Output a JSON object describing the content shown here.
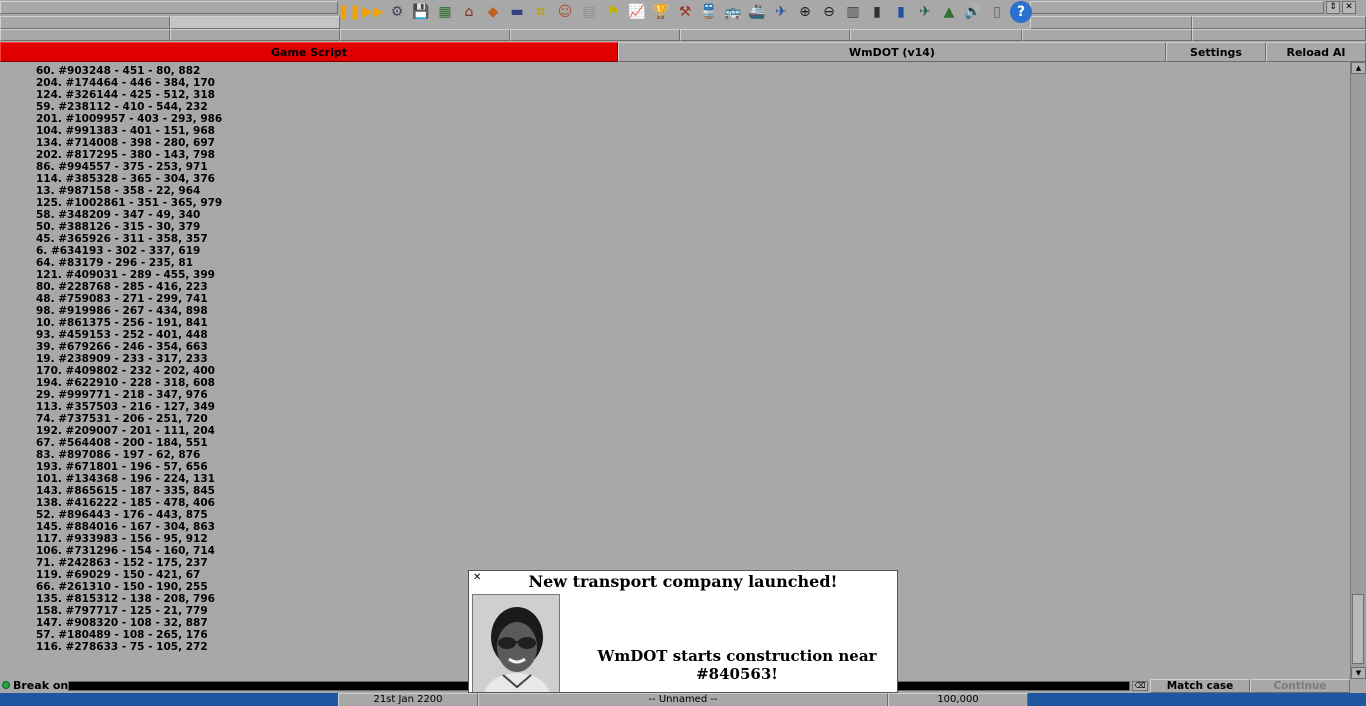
{
  "toolbar": {
    "window_buttons": [
      "⇕",
      "✕"
    ],
    "icons": [
      {
        "name": "pause-icon",
        "glyph": "❚❚",
        "color": "#f0a000"
      },
      {
        "name": "fast-forward-icon",
        "glyph": "▶▶",
        "color": "#f0a000"
      },
      {
        "name": "settings-gear-icon",
        "glyph": "⚙",
        "color": "#404860"
      },
      {
        "name": "save-icon",
        "glyph": "💾",
        "color": "#2040a0"
      },
      {
        "name": "map-icon",
        "glyph": "▦",
        "color": "#307030"
      },
      {
        "name": "town-directory-icon",
        "glyph": "⌂",
        "color": "#803020"
      },
      {
        "name": "subsidies-icon",
        "glyph": "◆",
        "color": "#c06020"
      },
      {
        "name": "station-list-icon",
        "glyph": "▬",
        "color": "#304080"
      },
      {
        "name": "finances-icon",
        "glyph": "¤",
        "color": "#c0a000"
      },
      {
        "name": "company-icon",
        "glyph": "☺",
        "color": "#b05030"
      },
      {
        "name": "story-book-icon",
        "glyph": "▤",
        "color": "#909090"
      },
      {
        "name": "goals-icon",
        "glyph": "⚑",
        "color": "#c0b000"
      },
      {
        "name": "graphs-icon",
        "glyph": "📈",
        "color": "#2050c0"
      },
      {
        "name": "league-table-icon",
        "glyph": "🏆",
        "color": "#d0a000"
      },
      {
        "name": "industries-icon",
        "glyph": "⚒",
        "color": "#a03020"
      },
      {
        "name": "trains-icon",
        "glyph": "🚆",
        "color": "#2050a0"
      },
      {
        "name": "road-vehicles-icon",
        "glyph": "🚌",
        "color": "#2050c0"
      },
      {
        "name": "ships-icon",
        "glyph": "🚢",
        "color": "#505050"
      },
      {
        "name": "aircraft-icon",
        "glyph": "✈",
        "color": "#2050a0"
      },
      {
        "name": "zoom-in-icon",
        "glyph": "⊕",
        "color": "#202020"
      },
      {
        "name": "zoom-out-icon",
        "glyph": "⊖",
        "color": "#202020"
      },
      {
        "name": "build-railway-icon",
        "glyph": "▥",
        "color": "#404040"
      },
      {
        "name": "build-road-icon",
        "glyph": "▮",
        "color": "#303030"
      },
      {
        "name": "build-tram-icon",
        "glyph": "▮",
        "color": "#2050a0"
      },
      {
        "name": "build-airport-icon",
        "glyph": "✈",
        "color": "#206040"
      },
      {
        "name": "landscaping-icon",
        "glyph": "▲",
        "color": "#307030"
      },
      {
        "name": "music-sound-icon",
        "glyph": "🔊",
        "color": "#404040"
      },
      {
        "name": "messages-icon",
        "glyph": "▯",
        "color": "#606060"
      },
      {
        "name": "help-icon",
        "glyph": "?",
        "color": "#ffffff"
      }
    ]
  },
  "debug": {
    "game_script_label": "Game Script",
    "ai_title": "WmDOT (v14)",
    "settings_label": "Settings",
    "reload_label": "Reload AI"
  },
  "log_lines": [
    "60. #903248 - 451 - 80, 882",
    "204. #174464 - 446 - 384, 170",
    "124. #326144 - 425 - 512, 318",
    "59. #238112 - 410 - 544, 232",
    "201. #1009957 - 403 - 293, 986",
    "104. #991383 - 401 - 151, 968",
    "134. #714008 - 398 - 280, 697",
    "202. #817295 - 380 - 143, 798",
    "86. #994557 - 375 - 253, 971",
    "114. #385328 - 365 - 304, 376",
    "13. #987158 - 358 - 22, 964",
    "125. #1002861 - 351 - 365, 979",
    "58. #348209 - 347 - 49, 340",
    "50. #388126 - 315 - 30, 379",
    "45. #365926 - 311 - 358, 357",
    "6. #634193 - 302 - 337, 619",
    "64. #83179 - 296 - 235, 81",
    "121. #409031 - 289 - 455, 399",
    "80. #228768 - 285 - 416, 223",
    "48. #759083 - 271 - 299, 741",
    "98. #919986 - 267 - 434, 898",
    "10. #861375 - 256 - 191, 841",
    "93. #459153 - 252 - 401, 448",
    "39. #679266 - 246 - 354, 663",
    "19. #238909 - 233 - 317, 233",
    "170. #409802 - 232 - 202, 400",
    "194. #622910 - 228 - 318, 608",
    "29. #999771 - 218 - 347, 976",
    "113. #357503 - 216 - 127, 349",
    "74. #737531 - 206 - 251, 720",
    "192. #209007 - 201 - 111, 204",
    "67. #564408 - 200 - 184, 551",
    "83. #897086 - 197 - 62, 876",
    "193. #671801 - 196 - 57, 656",
    "101. #134368 - 196 - 224, 131",
    "143. #865615 - 187 - 335, 845",
    "138. #416222 - 185 - 478, 406",
    "52. #896443 - 176 - 443, 875",
    "145. #884016 - 167 - 304, 863",
    "117. #933983 - 156 - 95, 912",
    "106. #731296 - 154 - 160, 714",
    "71. #242863 - 152 - 175, 237",
    "119. #69029 - 150 - 421, 67",
    "66. #261310 - 150 - 190, 255",
    "135. #815312 - 138 - 208, 796",
    "158. #797717 - 125 - 21, 779",
    "147. #908320 - 108 - 32, 887",
    "57. #180489 - 108 - 265, 176",
    "116. #278633 - 75 - 105, 272"
  ],
  "break_bar": {
    "label": "Break on:",
    "input_value": "",
    "clear_glyph": "⌫",
    "match_case_label": "Match case",
    "continue_label": "Continue"
  },
  "news": {
    "close_glyph": "✕",
    "headline": "New transport company launched!",
    "body": "WmDOT starts construction near #840563!"
  },
  "status": {
    "date": "21st Jan 2200",
    "company": "-- Unnamed --",
    "money": "100,000"
  },
  "colors": {
    "game_script_tab": "#e00000",
    "status_bar_bg": "#1f56a0",
    "window_bg": "#a8a8a8"
  }
}
